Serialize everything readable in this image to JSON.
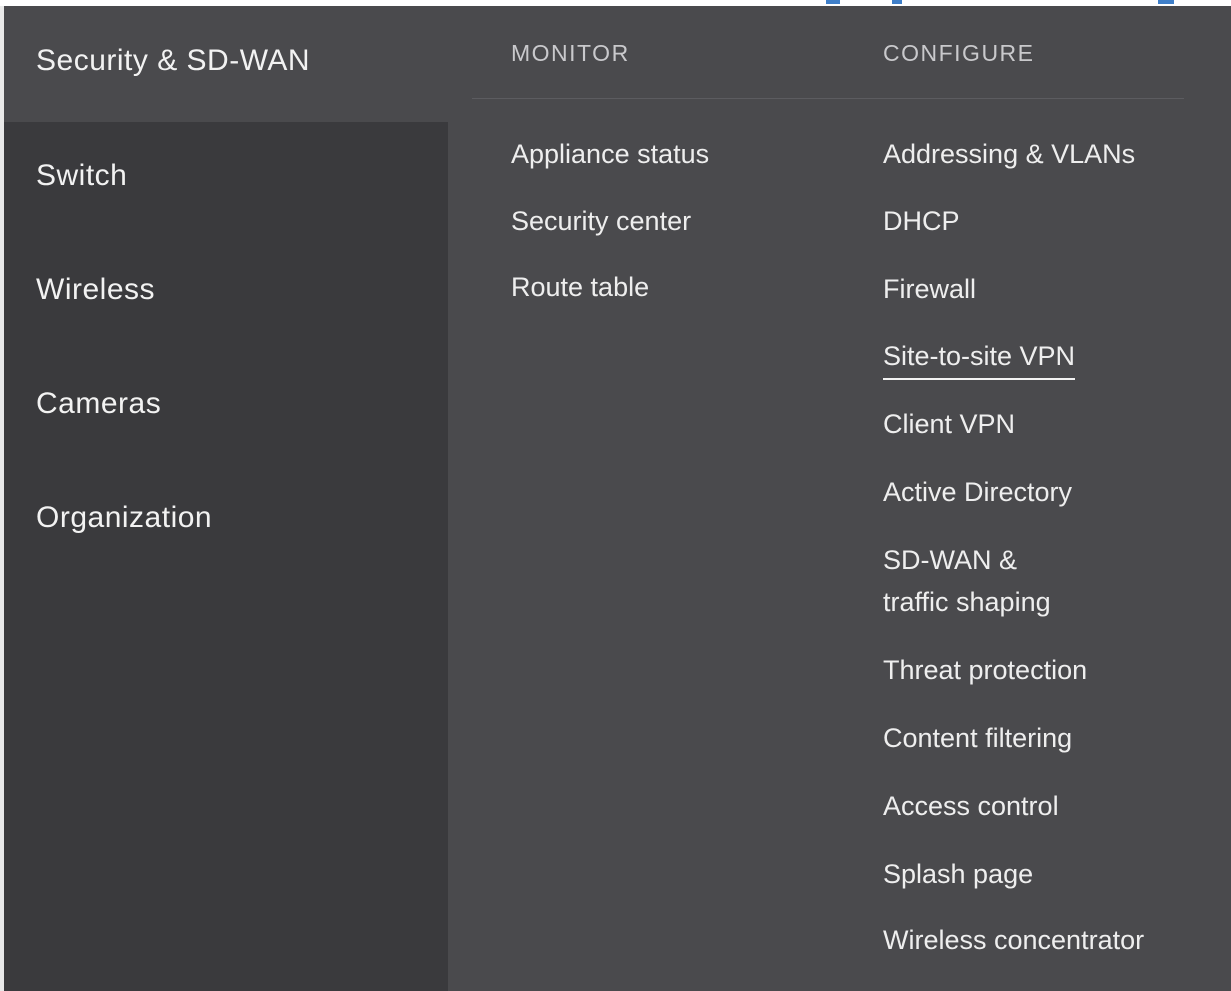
{
  "sidebar": {
    "items": [
      {
        "label": "Security & SD-WAN",
        "active": true
      },
      {
        "label": "Switch"
      },
      {
        "label": "Wireless"
      },
      {
        "label": "Cameras"
      },
      {
        "label": "Organization"
      }
    ]
  },
  "menu": {
    "monitor": {
      "header": "MONITOR",
      "links": [
        "Appliance status",
        "Security center",
        "Route table"
      ]
    },
    "configure": {
      "header": "CONFIGURE",
      "links": [
        "Addressing & VLANs",
        "DHCP",
        "Firewall",
        "Site-to-site VPN",
        "Client VPN",
        "Active Directory",
        "SD-WAN &",
        "traffic shaping",
        "Threat protection",
        "Content filtering",
        "Access control",
        "Splash page",
        "Wireless concentrator"
      ],
      "active": "Site-to-site VPN"
    }
  },
  "colors": {
    "panel": "#4a4a4d",
    "sidebar": "#3a3a3d",
    "text": "#eeeeee",
    "header_text": "#c9c9cc"
  }
}
